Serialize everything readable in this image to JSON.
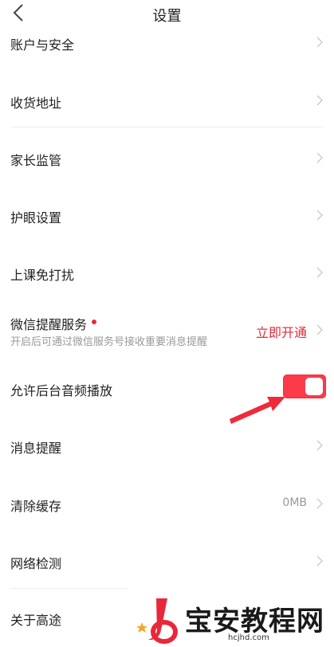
{
  "header": {
    "title": "设置"
  },
  "rows": [
    {
      "label": "账户与安全"
    },
    {
      "label": "收货地址"
    },
    {
      "label": "家长监管"
    },
    {
      "label": "护眼设置"
    },
    {
      "label": "上课免打扰"
    },
    {
      "label": "微信提醒服务",
      "subtitle": "开启后可通过微信服务号接收重要消息提醒",
      "action": "立即开通"
    },
    {
      "label": "允许后台音频播放",
      "toggle_on": true
    },
    {
      "label": "消息提醒"
    },
    {
      "label": "清除缓存",
      "value": "0MB"
    },
    {
      "label": "网络检测"
    },
    {
      "label": "关于高途"
    }
  ],
  "watermark": {
    "text": "宝安教程网",
    "url": "hcjhd.com"
  },
  "colors": {
    "accent": "#e8283a",
    "toggle": "#fb3a4a",
    "annotation_arrow": "#f02a3a"
  },
  "icons": {
    "back": "chevron-left-icon",
    "row_arrow": "chevron-right-icon"
  }
}
